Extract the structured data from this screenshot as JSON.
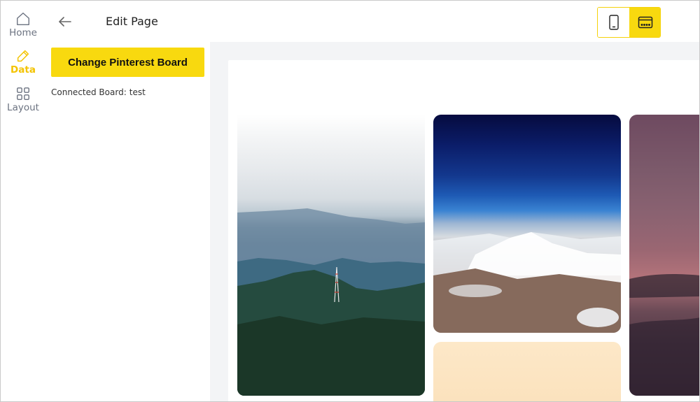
{
  "rail": {
    "items": [
      {
        "label": "Home",
        "icon": "home-icon"
      },
      {
        "label": "Data",
        "icon": "pencil-icon",
        "active": true
      },
      {
        "label": "Layout",
        "icon": "grid-icon"
      }
    ]
  },
  "header": {
    "title": "Edit Page",
    "back_icon": "arrow-left-icon",
    "device_toggle": {
      "mobile_icon": "mobile-icon",
      "desktop_icon": "desktop-icon",
      "selected": "desktop"
    }
  },
  "data_panel": {
    "button_label": "Change Pinterest Board",
    "connected_label": "Connected Board:",
    "connected_value": "test"
  },
  "preview": {
    "pins": [
      {
        "subject": "mountain-with-radio-tower"
      },
      {
        "subject": "snowy-mountains-from-above"
      },
      {
        "subject": "peach-background"
      },
      {
        "subject": "pink-sunset-sky"
      }
    ]
  },
  "colors": {
    "accent": "#f8d90f",
    "active_text": "#f3c300",
    "preview_bg": "#f3f4f6"
  }
}
